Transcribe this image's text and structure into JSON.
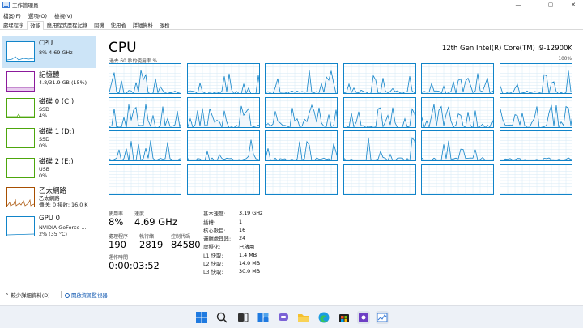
{
  "window": {
    "title": "工作管理員",
    "controls": {
      "minimize": "—",
      "maximize": "▢",
      "close": "✕"
    }
  },
  "menu": [
    "檔案(F)",
    "選項(O)",
    "檢視(V)"
  ],
  "tabs": [
    {
      "label": "處理程序",
      "active": false
    },
    {
      "label": "效能",
      "active": true
    },
    {
      "label": "應用程式歷程記錄",
      "active": false
    },
    {
      "label": "開機",
      "active": false
    },
    {
      "label": "使用者",
      "active": false
    },
    {
      "label": "詳細資料",
      "active": false
    },
    {
      "label": "服務",
      "active": false
    }
  ],
  "sidebar": {
    "items": [
      {
        "name": "CPU",
        "lines": [
          "8% 4.69 GHz"
        ],
        "color": "#1184c9",
        "selected": true
      },
      {
        "name": "記憶體",
        "lines": [
          "4.8/31.9 GB (15%)"
        ],
        "color": "#8b1a9b",
        "selected": false
      },
      {
        "name": "磁碟 0 (C:)",
        "lines": [
          "SSD",
          "4%"
        ],
        "color": "#4da60c",
        "selected": false
      },
      {
        "name": "磁碟 1 (D:)",
        "lines": [
          "SSD",
          "0%"
        ],
        "color": "#4da60c",
        "selected": false
      },
      {
        "name": "磁碟 2 (E:)",
        "lines": [
          "USB",
          "0%"
        ],
        "color": "#4da60c",
        "selected": false
      },
      {
        "name": "乙太網路",
        "lines": [
          "乙太網路",
          "傳送: 0 接收: 16.0 K"
        ],
        "color": "#a74f01",
        "selected": false
      },
      {
        "name": "GPU 0",
        "lines": [
          "NVIDIA GeForce ...",
          "2% (35 °C)"
        ],
        "color": "#1184c9",
        "selected": false
      }
    ]
  },
  "main": {
    "title": "CPU",
    "model": "12th Gen Intel(R) Core(TM) i9-12900K",
    "graph_caption": "過去 60 秒的使用率 %",
    "graph_max": "100%",
    "stats": {
      "utilization_label": "使用率",
      "utilization": "8%",
      "speed_label": "速度",
      "speed": "4.69 GHz",
      "processes_label": "處理程序",
      "processes": "190",
      "threads_label": "執行緒",
      "threads": "2819",
      "handles_label": "控制代碼",
      "handles": "84580",
      "uptime_label": "運作時間",
      "uptime": "0:00:03:52"
    },
    "specs": [
      {
        "label": "基本速度:",
        "value": "3.19 GHz"
      },
      {
        "label": "插槽:",
        "value": "1"
      },
      {
        "label": "核心數目:",
        "value": "16"
      },
      {
        "label": "邏輯處理器:",
        "value": "24"
      },
      {
        "label": "虛擬化:",
        "value": "已啟用"
      },
      {
        "label": "L1 快取:",
        "value": "1.4 MB"
      },
      {
        "label": "L2 快取:",
        "value": "14.0 MB"
      },
      {
        "label": "L3 快取:",
        "value": "30.0 MB"
      }
    ]
  },
  "footer": {
    "fewer_details": "較少詳細資料(D)",
    "resource_monitor": "開啟資源監視器"
  },
  "taskbar": [
    "start-icon",
    "search-icon",
    "task-view-icon",
    "widgets-icon",
    "chat-icon",
    "file-explorer-icon",
    "edge-icon",
    "store-icon",
    "app-icon",
    "task-manager-icon"
  ]
}
